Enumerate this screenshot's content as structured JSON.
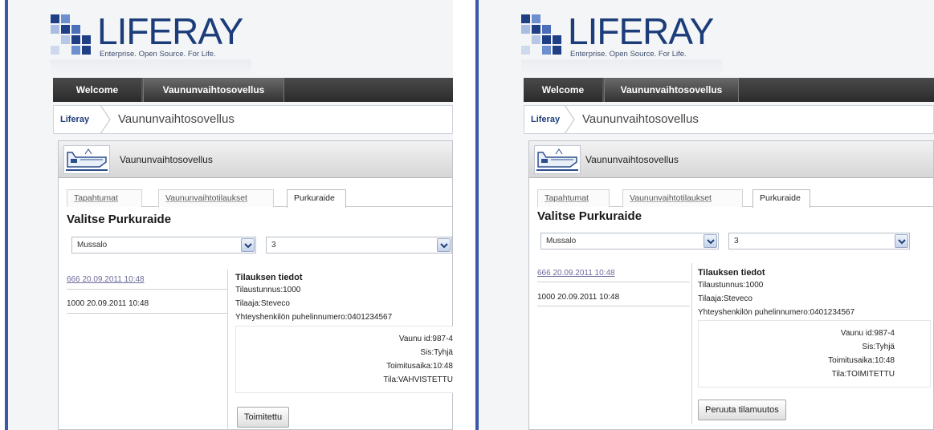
{
  "panels": [
    {
      "logo": {
        "word": "LIFERAY",
        "tagline": "Enterprise. Open Source. For Life."
      },
      "nav": {
        "tabs": [
          "Welcome",
          "Vaununvaihtosovellus"
        ]
      },
      "breadcrumb": {
        "home": "Liferay",
        "current": "Vaununvaihtosovellus"
      },
      "portlet": {
        "title": "Vaununvaihtosovellus"
      },
      "tabs": [
        "Tapahtumat",
        "Vaununvaihtotilaukset",
        "Purkuraide"
      ],
      "heading": "Valitse Purkuraide",
      "select_location": "Mussalo",
      "select_track": "3",
      "list": [
        "666 20.09.2011 10:48",
        "1000 20.09.2011 10:48"
      ],
      "details": {
        "title": "Tilauksen tiedot",
        "order_id": "Tilaustunnus:1000",
        "customer": "Tilaaja:Steveco",
        "phone": "Yhteyshenkilön puhelinnumero:0401234567"
      },
      "wagon": {
        "id": "Vaunu id:987-4",
        "content": "Sis:Tyhjä",
        "delivery": "Toimitusaika:10:48",
        "status": "Tila:VAHVISTETTU"
      },
      "action_button": "Toimitettu"
    },
    {
      "logo": {
        "word": "LIFERAY",
        "tagline": "Enterprise. Open Source. For Life."
      },
      "nav": {
        "tabs": [
          "Welcome",
          "Vaununvaihtosovellus"
        ]
      },
      "breadcrumb": {
        "home": "Liferay",
        "current": "Vaununvaihtosovellus"
      },
      "portlet": {
        "title": "Vaununvaihtosovellus"
      },
      "tabs": [
        "Tapahtumat",
        "Vaununvaihtotilaukset",
        "Purkuraide"
      ],
      "heading": "Valitse Purkuraide",
      "select_location": "Mussalo",
      "select_track": "3",
      "list": [
        "666 20.09.2011 10:48",
        "1000 20.09.2011 10:48"
      ],
      "details": {
        "title": "Tilauksen tiedot",
        "order_id": "Tilaustunnus:1000",
        "customer": "Tilaaja:Steveco",
        "phone": "Yhteyshenkilön puhelinnumero:0401234567"
      },
      "wagon": {
        "id": "Vaunu id:987-4",
        "content": "Sis:Tyhjä",
        "delivery": "Toimitusaika:10:48",
        "status": "Tila:TOIMITETTU"
      },
      "action_button": "Peruuta tilamuutos"
    }
  ],
  "colors": {
    "accent_border": "#3a57a8",
    "logo_blue": "#1c3d7a",
    "nav_dark": "#2b2b2b"
  }
}
